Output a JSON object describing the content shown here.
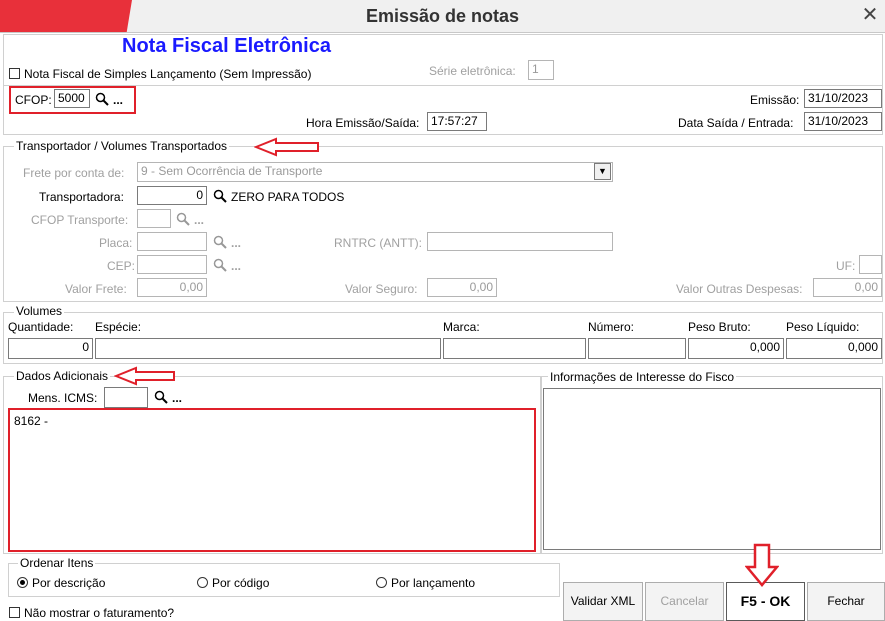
{
  "window": {
    "title": "Emissão de notas",
    "close_glyph": "✕"
  },
  "header": {
    "app_title": "Nota Fiscal Eletrônica",
    "simples_label": "Nota Fiscal de Simples Lançamento (Sem Impressão)",
    "serie_label": "Série eletrônica:",
    "serie_value": "1",
    "cfop_label": "CFOP:",
    "cfop_value": "5000",
    "emissao_label": "Emissão:",
    "emissao_value": "31/10/2023",
    "hora_label": "Hora Emissão/Saída:",
    "hora_value": "17:57:27",
    "data_saida_label": "Data Saída / Entrada:",
    "data_saida_value": "31/10/2023"
  },
  "transport": {
    "legend": "Transportador /  Volumes Transportados",
    "frete_label": "Frete por conta de:",
    "frete_value": "9 - Sem Ocorrência de Transporte",
    "transportadora_label": "Transportadora:",
    "transportadora_value": "0",
    "transportadora_name": "ZERO PARA TODOS",
    "cfop_transp_label": "CFOP Transporte:",
    "placa_label": "Placa:",
    "rntrc_label": "RNTRC (ANTT):",
    "cep_label": "CEP:",
    "uf_label": "UF:",
    "valor_frete_label": "Valor Frete:",
    "valor_frete_value": "0,00",
    "valor_seguro_label": "Valor Seguro:",
    "valor_seguro_value": "0,00",
    "outras_label": "Valor Outras Despesas:",
    "outras_value": "0,00"
  },
  "volumes": {
    "legend": "Volumes",
    "quantidade_label": "Quantidade:",
    "quantidade_value": "0",
    "especie_label": "Espécie:",
    "marca_label": "Marca:",
    "numero_label": "Número:",
    "peso_bruto_label": "Peso Bruto:",
    "peso_bruto_value": "0,000",
    "peso_liquido_label": "Peso Líquido:",
    "peso_liquido_value": "0,000"
  },
  "adicionais": {
    "legend": "Dados Adicionais",
    "mens_icms_label": "Mens. ICMS:",
    "text": "8162 -",
    "fisco_legend": "Informações de Interesse do Fisco"
  },
  "ordenar": {
    "legend": "Ordenar Itens",
    "options": [
      "Por descrição",
      "Por código",
      "Por lançamento"
    ],
    "selected": "Por descrição"
  },
  "footer": {
    "nao_mostrar_label": "Não mostrar o faturamento?",
    "validar_label": "Validar XML",
    "cancelar_label": "Cancelar",
    "ok_label": "F5 - OK",
    "fechar_label": "Fechar"
  },
  "ellipsis": "...",
  "colors": {
    "accent_red": "#e0202a",
    "title_blue": "#1a1aff"
  }
}
